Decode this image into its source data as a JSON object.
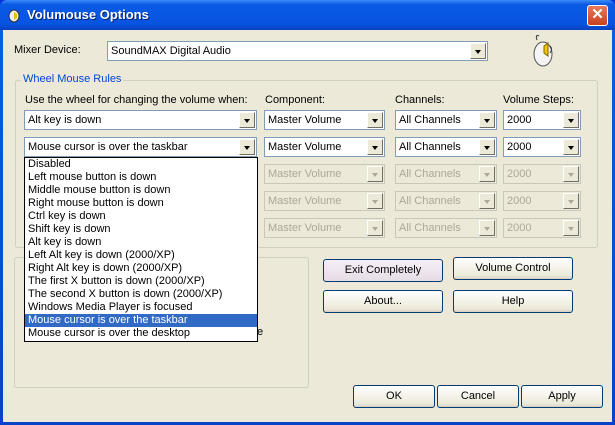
{
  "window": {
    "title": "Volumouse Options",
    "close_label": "✕"
  },
  "mixer": {
    "label": "Mixer Device:",
    "value": "SoundMAX Digital Audio"
  },
  "rules": {
    "legend": "Wheel Mouse Rules",
    "headers": {
      "condition": "Use the wheel for changing the volume when:",
      "component": "Component:",
      "channels": "Channels:",
      "steps": "Volume Steps:"
    },
    "rows": [
      {
        "condition": "Alt key is down",
        "component": "Master Volume",
        "channels": "All Channels",
        "steps": "2000",
        "enabled": true
      },
      {
        "condition": "Mouse cursor is over the taskbar",
        "component": "Master Volume",
        "channels": "All Channels",
        "steps": "2000",
        "enabled": true
      },
      {
        "condition": "",
        "component": "Master Volume",
        "channels": "All Channels",
        "steps": "2000",
        "enabled": false
      },
      {
        "condition": "",
        "component": "Master Volume",
        "channels": "All Channels",
        "steps": "2000",
        "enabled": false
      },
      {
        "condition": "",
        "component": "Master Volume",
        "channels": "All Channels",
        "steps": "2000",
        "enabled": false
      }
    ]
  },
  "dropdown": {
    "selected_index": 11,
    "options": [
      "Disabled",
      "Left mouse button is down",
      "Middle mouse button is down",
      "Right mouse button is down",
      "Ctrl key is down",
      "Shift key is down",
      "Alt key is down",
      "Left Alt key is down  (2000/XP)",
      "Right Alt key is down  (2000/XP)",
      "The first X button is down  (2000/XP)",
      "The second X button is down  (2000/XP)",
      "Windows Media Player is focused",
      "Mouse cursor is over the taskbar",
      "Mouse cursor is over the desktop"
    ]
  },
  "hidden_fragment": "e",
  "buttons": {
    "exit": "Exit Completely",
    "volume_control": "Volume Control",
    "about": "About...",
    "help": "Help",
    "ok": "OK",
    "cancel": "Cancel",
    "apply": "Apply"
  }
}
